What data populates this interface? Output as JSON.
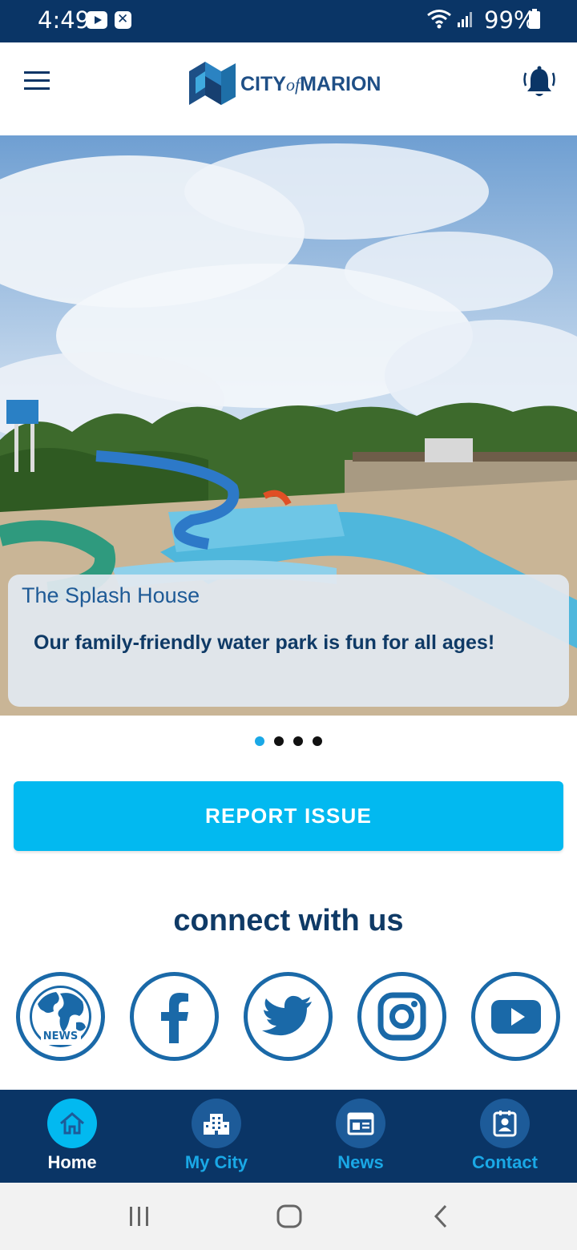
{
  "status_bar": {
    "time": "4:49",
    "battery": "99%"
  },
  "header": {
    "logo": {
      "city": "CITY",
      "of": "of",
      "name": "MARION"
    }
  },
  "hero": {
    "title": "The Splash House",
    "description": "Our family-friendly water park is fun for all ages!",
    "slides": 4,
    "active_slide": 1
  },
  "report_button": "REPORT ISSUE",
  "connect": {
    "heading": "connect with us",
    "links": [
      {
        "name": "news",
        "label": "NEWS"
      },
      {
        "name": "facebook",
        "label": "f"
      },
      {
        "name": "twitter"
      },
      {
        "name": "instagram"
      },
      {
        "name": "youtube"
      }
    ]
  },
  "bottom_nav": {
    "items": [
      {
        "label": "Home",
        "icon": "home-icon",
        "active": true
      },
      {
        "label": "My City",
        "icon": "buildings-icon",
        "active": false
      },
      {
        "label": "News",
        "icon": "newspaper-icon",
        "active": false
      },
      {
        "label": "Contact",
        "icon": "contact-card-icon",
        "active": false
      }
    ]
  },
  "colors": {
    "navy": "#0a3566",
    "accent": "#02b9f0",
    "icon_blue": "#1a69a8"
  }
}
